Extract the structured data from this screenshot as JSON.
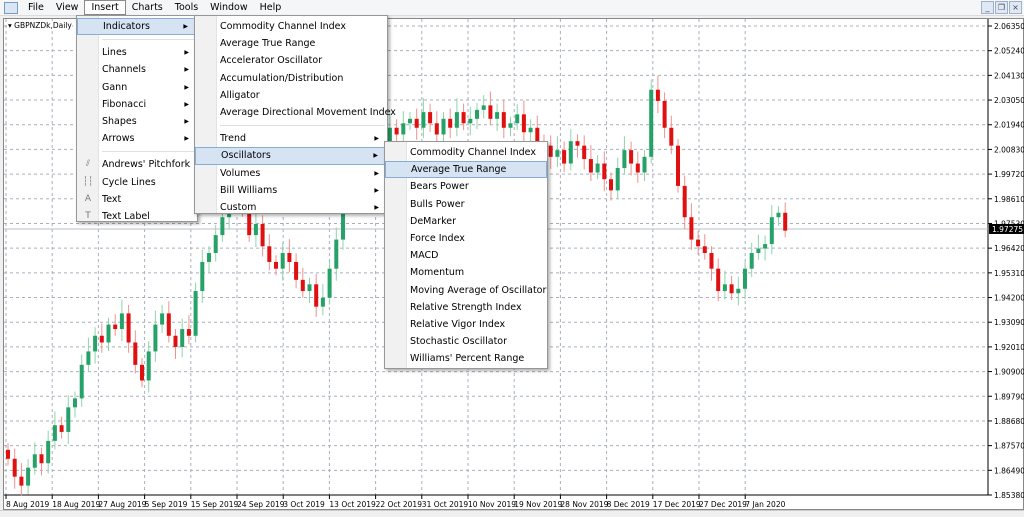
{
  "menubar": {
    "items": [
      "File",
      "View",
      "Insert",
      "Charts",
      "Tools",
      "Window",
      "Help"
    ],
    "active": "Insert"
  },
  "window_buttons": {
    "minimize": "_",
    "restore": "❐",
    "close": "×"
  },
  "chart": {
    "symbol_label": "GBPNZDk,Daily",
    "current_price": "1.97275"
  },
  "insert_menu": {
    "group1": [
      {
        "label": "Indicators",
        "submenu": true
      }
    ],
    "group2": [
      {
        "label": "Lines"
      },
      {
        "label": "Channels"
      },
      {
        "label": "Gann"
      },
      {
        "label": "Fibonacci"
      },
      {
        "label": "Shapes"
      },
      {
        "label": "Arrows"
      }
    ],
    "group3": [
      {
        "label": "Andrews' Pitchfork",
        "icon": "pitchfork-icon"
      },
      {
        "label": "Cycle Lines",
        "icon": "cycle-lines-icon"
      },
      {
        "label": "Text",
        "icon": "text-icon"
      },
      {
        "label": "Text Label",
        "icon": "text-label-icon"
      }
    ]
  },
  "indicators_menu": {
    "group1": [
      "Commodity Channel Index",
      "Average True Range",
      "Accelerator Oscillator",
      "Accumulation/Distribution",
      "Alligator",
      "Average Directional Movement Index"
    ],
    "group2": [
      "Trend",
      "Oscillators",
      "Volumes",
      "Bill Williams",
      "Custom"
    ],
    "highlighted": "Oscillators"
  },
  "oscillators_menu": {
    "items": [
      "Commodity Channel Index",
      "Average True Range",
      "Bears Power",
      "Bulls Power",
      "DeMarker",
      "Force Index",
      "MACD",
      "Momentum",
      "Moving Average of Oscillator",
      "Relative Strength Index",
      "Relative Vigor Index",
      "Stochastic Oscillator",
      "Williams' Percent Range"
    ],
    "highlighted": "Average True Range"
  },
  "colors": {
    "bull": "#26a269",
    "bull_light": "#8fd4a8",
    "bear": "#e01010",
    "grid": "#a8b0bc",
    "menu_highlight": "#d5e3f3"
  },
  "chart_data": {
    "type": "candlestick",
    "price_ticks": [
      "2.06350",
      "2.05240",
      "2.04130",
      "2.03050",
      "2.01940",
      "2.00830",
      "1.99720",
      "1.98610",
      "1.97530",
      "1.96420",
      "1.95310",
      "1.94200",
      "1.93090",
      "1.92010",
      "1.90900",
      "1.89790",
      "1.88680",
      "1.87570",
      "1.86490",
      "1.85380"
    ],
    "date_ticks": [
      "8 Aug 2019",
      "18 Aug 2019",
      "27 Aug 2019",
      "5 Sep 2019",
      "15 Sep 2019",
      "24 Sep 2019",
      "3 Oct 2019",
      "13 Oct 2019",
      "22 Oct 2019",
      "31 Oct 2019",
      "10 Nov 2019",
      "19 Nov 2019",
      "28 Nov 2019",
      "8 Dec 2019",
      "17 Dec 2019",
      "27 Dec 2019",
      "7 Jan 2020"
    ],
    "ylim": [
      1.8538,
      2.0635
    ],
    "closes": [
      1.87,
      1.862,
      1.858,
      1.866,
      1.872,
      1.868,
      1.878,
      1.885,
      1.882,
      1.893,
      1.897,
      1.912,
      1.918,
      1.925,
      1.922,
      1.93,
      1.928,
      1.935,
      1.922,
      1.912,
      1.905,
      1.918,
      1.93,
      1.935,
      1.925,
      1.92,
      1.928,
      1.925,
      1.945,
      1.958,
      1.962,
      1.97,
      1.978,
      1.985,
      1.99,
      1.982,
      1.97,
      1.975,
      1.965,
      1.958,
      1.955,
      1.962,
      1.958,
      1.95,
      1.945,
      1.948,
      1.938,
      1.942,
      1.955,
      1.968,
      1.985,
      1.995,
      2.0,
      2.005,
      2.01,
      2.008,
      2.012,
      2.018,
      2.015,
      2.02,
      2.022,
      2.018,
      2.025,
      2.02,
      2.015,
      2.022,
      2.018,
      2.025,
      2.02,
      2.022,
      2.026,
      2.028,
      2.022,
      2.025,
      2.018,
      2.02,
      2.024,
      2.016,
      2.018,
      2.012,
      2.01,
      2.005,
      2.008,
      2.002,
      2.012,
      2.01,
      2.004,
      1.998,
      2.002,
      1.995,
      1.99,
      2.0,
      2.008,
      2.002,
      1.998,
      2.005,
      2.035,
      2.03,
      2.018,
      2.01,
      1.992,
      1.978,
      1.968,
      1.965,
      1.962,
      1.955,
      1.945,
      1.948,
      1.944,
      1.946,
      1.955,
      1.962,
      1.964,
      1.966,
      1.978,
      1.98,
      1.972
    ],
    "grid": true
  }
}
